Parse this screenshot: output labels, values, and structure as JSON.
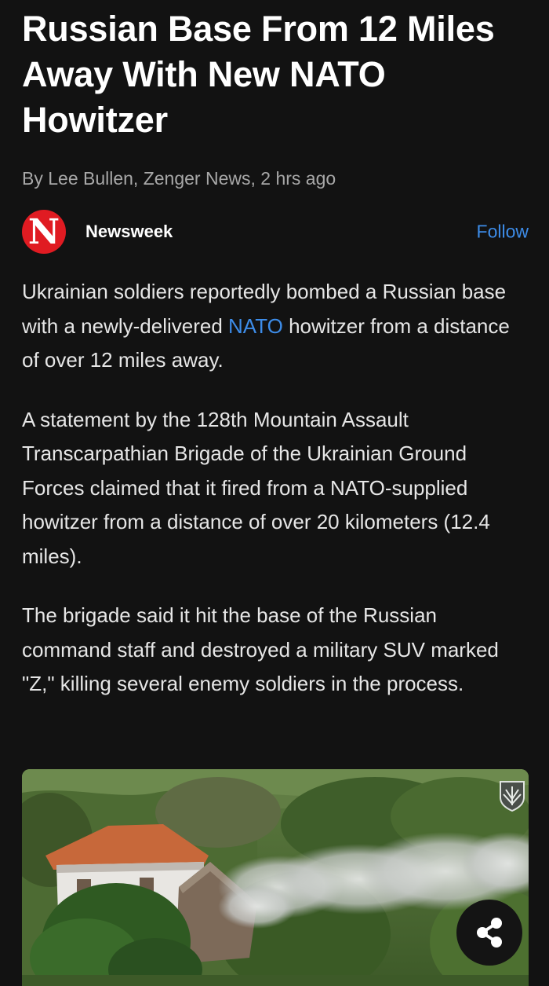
{
  "article": {
    "headline": "Russian Base From 12 Miles Away With New NATO Howitzer",
    "byline": "By Lee Bullen, Zenger News, 2 hrs ago"
  },
  "publisher": {
    "logo_letter": "N",
    "name": "Newsweek",
    "follow_label": "Follow",
    "brand_color": "#e01b22",
    "link_color": "#3d8ce8"
  },
  "paragraphs": {
    "p1_before": "Ukrainian soldiers reportedly bombed a Russian base with a newly-delivered ",
    "p1_link": "NATO",
    "p1_after": " howitzer from a distance of over 12 miles away.",
    "p2": "A statement by the 128th Mountain Assault Transcarpathian Brigade of the Ukrainian Ground Forces claimed that it fired from a NATO-supplied howitzer from a distance of over 20 kilometers (12.4 miles).",
    "p3": "The brigade said it hit the base of the Russian command staff and destroyed a military SUV marked \"Z,\" killing several enemy soldiers in the process."
  },
  "media": {
    "emblem_icon": "brigade-emblem-icon",
    "share_icon": "share-icon"
  }
}
